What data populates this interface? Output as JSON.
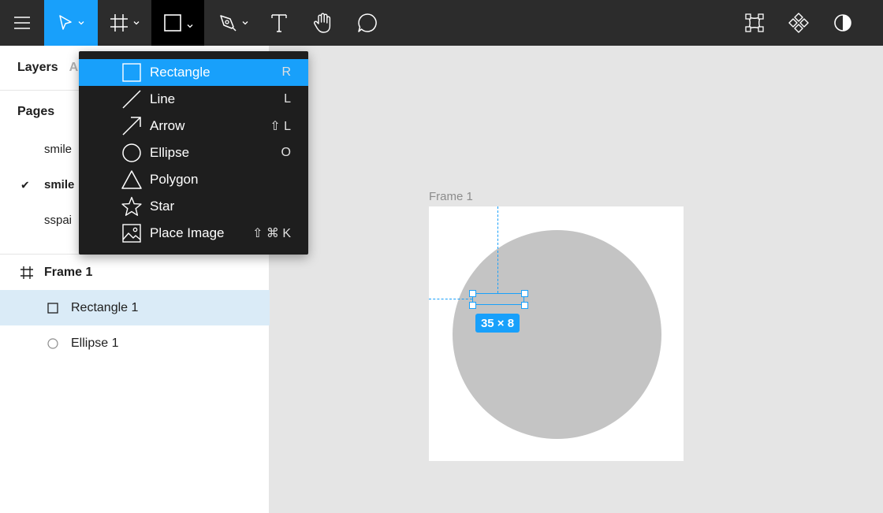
{
  "toolbar": {
    "tools": [
      {
        "name": "main-menu",
        "icon": "hamburger-icon"
      },
      {
        "name": "move-tool",
        "icon": "cursor-arrow-icon",
        "active": true
      },
      {
        "name": "frame-tool",
        "icon": "frame-hash-icon"
      },
      {
        "name": "shape-tool",
        "icon": "rectangle-icon",
        "open": true
      },
      {
        "name": "pen-tool",
        "icon": "pen-icon"
      },
      {
        "name": "text-tool",
        "icon": "text-icon"
      },
      {
        "name": "hand-tool",
        "icon": "hand-icon"
      },
      {
        "name": "comment-tool",
        "icon": "comment-icon"
      },
      {
        "name": "edit-object",
        "icon": "vector-nodes-icon"
      },
      {
        "name": "components",
        "icon": "components-icon"
      },
      {
        "name": "appearance",
        "icon": "half-circle-contrast-icon"
      }
    ],
    "accent": "#18a0fb"
  },
  "shape_menu": {
    "items": [
      {
        "label": "Rectangle",
        "shortcut": "R",
        "icon": "rectangle-icon",
        "highlighted": true
      },
      {
        "label": "Line",
        "shortcut": "L",
        "icon": "line-icon"
      },
      {
        "label": "Arrow",
        "shortcut": "⇧ L",
        "icon": "arrow-icon"
      },
      {
        "label": "Ellipse",
        "shortcut": "O",
        "icon": "ellipse-icon"
      },
      {
        "label": "Polygon",
        "shortcut": "",
        "icon": "polygon-icon"
      },
      {
        "label": "Star",
        "shortcut": "",
        "icon": "star-icon"
      },
      {
        "label": "Place Image",
        "shortcut": "⇧ ⌘ K",
        "icon": "image-icon"
      }
    ]
  },
  "left_panel": {
    "tabs": [
      {
        "label": "Layers"
      },
      {
        "label": "A"
      }
    ],
    "pages_title": "Pages",
    "pages": [
      {
        "label": "smile",
        "current": false
      },
      {
        "label": "smile",
        "current": true
      },
      {
        "label": "sspai",
        "current": false
      }
    ],
    "layers": [
      {
        "label": "Frame 1",
        "icon": "frame-hash-icon",
        "selected": false
      },
      {
        "label": "Rectangle 1",
        "icon": "rectangle-icon",
        "selected": true
      },
      {
        "label": "Ellipse 1",
        "icon": "ellipse-icon",
        "selected": false
      }
    ]
  },
  "canvas": {
    "frame_label": "Frame 1",
    "size_badge": "35 × 8",
    "frame_fill": "#ffffff",
    "ellipse_fill": "#c4c4c4"
  }
}
